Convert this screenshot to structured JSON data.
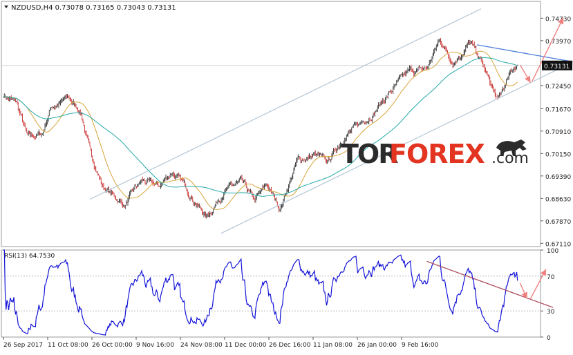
{
  "chart_data": [
    {
      "type": "candlestick",
      "symbol": "NZDUSD,H4",
      "ohlc_readout": [
        "0.73078",
        "0.73165",
        "0.73043",
        "0.73131"
      ],
      "current_price": "0.73131",
      "y_ticks": [
        "0.74730",
        "0.73970",
        "0.72450",
        "0.71670",
        "0.70910",
        "0.70150",
        "0.69390",
        "0.68630",
        "0.67870",
        "0.67110"
      ],
      "ylim": [
        0.67,
        0.753
      ],
      "x_ticks": [
        "26 Sep 2017",
        "11 Oct 08:00",
        "26 Oct 00:00",
        "9 Nov 16:00",
        "24 Nov 08:00",
        "11 Dec 00:00",
        "26 Dec 16:00",
        "11 Jan 08:00",
        "26 Jan 00:00",
        "9 Feb 16:00"
      ],
      "anchors": [
        [
          0,
          0.7215
        ],
        [
          15,
          0.7185
        ],
        [
          28,
          0.7065
        ],
        [
          45,
          0.708
        ],
        [
          55,
          0.7175
        ],
        [
          75,
          0.72
        ],
        [
          90,
          0.7155
        ],
        [
          100,
          0.702
        ],
        [
          115,
          0.6905
        ],
        [
          140,
          0.684
        ],
        [
          160,
          0.692
        ],
        [
          180,
          0.69
        ],
        [
          195,
          0.6955
        ],
        [
          215,
          0.6885
        ],
        [
          235,
          0.68
        ],
        [
          255,
          0.689
        ],
        [
          275,
          0.6915
        ],
        [
          290,
          0.685
        ],
        [
          305,
          0.6905
        ],
        [
          320,
          0.683
        ],
        [
          340,
          0.699
        ],
        [
          360,
          0.701
        ],
        [
          375,
          0.698
        ],
        [
          395,
          0.708
        ],
        [
          410,
          0.7105
        ],
        [
          430,
          0.7165
        ],
        [
          450,
          0.723
        ],
        [
          470,
          0.729
        ],
        [
          490,
          0.73
        ],
        [
          505,
          0.74
        ],
        [
          520,
          0.733
        ],
        [
          540,
          0.739
        ],
        [
          555,
          0.731
        ],
        [
          572,
          0.719
        ],
        [
          590,
          0.73
        ],
        [
          595,
          0.7313
        ]
      ],
      "series": [
        {
          "kind": "moving_average",
          "color": "#d8a33a",
          "period": 28
        },
        {
          "kind": "moving_average",
          "color": "#23a8a8",
          "period": 90
        }
      ],
      "channel": {
        "color": "#b9c9d8",
        "upper": [
          [
            100,
            0.686
          ],
          [
            553,
            0.7505
          ]
        ],
        "lower": [
          [
            252,
            0.6745
          ],
          [
            705,
            0.739
          ]
        ]
      },
      "trendline": {
        "color": "#4d7fd8",
        "points": [
          [
            548,
            0.7383
          ],
          [
            656,
            0.7327
          ]
        ]
      },
      "arrows": [
        {
          "color": "#f08080",
          "from": [
            598,
            0.7315
          ],
          "to": [
            610,
            0.7255
          ]
        },
        {
          "color": "#f08080",
          "from": [
            612,
            0.726
          ],
          "to": [
            648,
            0.7475
          ]
        }
      ],
      "grid": false,
      "brand": {
        "tor": "TOR",
        "forex": "FOREX",
        "com": ".com",
        "color_dark": "#2b2b2b",
        "color_accent": "#e33421",
        "logo_icon": "bull-icon"
      }
    },
    {
      "type": "line",
      "indicator": "RSI(13)",
      "current_value": "64.7530",
      "y_ticks": [
        "100",
        "70",
        "30",
        "0"
      ],
      "ylim": [
        0,
        100
      ],
      "color": "#1212d8",
      "levels": [
        30,
        70
      ],
      "trendline": {
        "color": "#b05060",
        "points": [
          [
            490,
            87
          ],
          [
            636,
            34
          ]
        ]
      },
      "arrows": [
        {
          "color": "#f08080",
          "from": [
            598,
            62
          ],
          "to": [
            606,
            44
          ]
        },
        {
          "color": "#f08080",
          "from": [
            610,
            44
          ],
          "to": [
            628,
            78
          ]
        }
      ]
    }
  ]
}
